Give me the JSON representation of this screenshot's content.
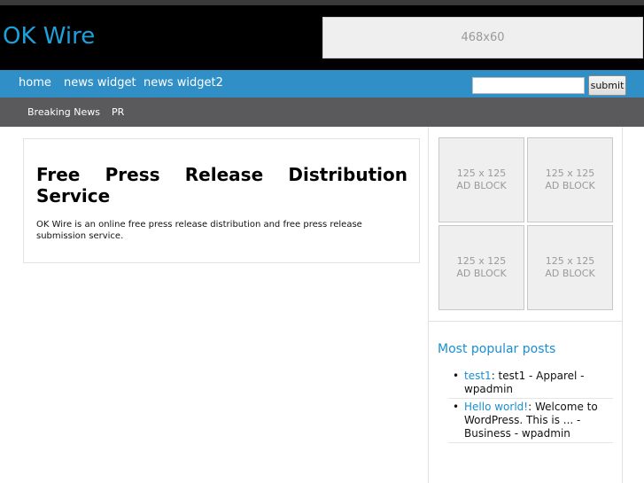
{
  "site": {
    "title": "OK Wire"
  },
  "banner": {
    "label": "468x60"
  },
  "nav": {
    "items": [
      {
        "label": "home"
      },
      {
        "label": "news widget"
      },
      {
        "label": "news widget2"
      }
    ],
    "search": {
      "value": "",
      "placeholder": "",
      "button_label": "submit"
    }
  },
  "subnav": {
    "items": [
      {
        "label": "Breaking News"
      },
      {
        "label": "PR"
      }
    ]
  },
  "post": {
    "title_line1": [
      "Free",
      "Press",
      "Release",
      "Distribution"
    ],
    "title_line2": "Service",
    "body": "OK Wire is an online free press release distribution and free press release submission service."
  },
  "ads": [
    {
      "size": "125 x 125",
      "label": "AD BLOCK"
    },
    {
      "size": "125 x 125",
      "label": "AD BLOCK"
    },
    {
      "size": "125 x 125",
      "label": "AD BLOCK"
    },
    {
      "size": "125 x 125",
      "label": "AD BLOCK"
    }
  ],
  "popular": {
    "title": "Most popular posts",
    "posts": [
      {
        "link": "test1",
        "rest": ": test1 - Apparel - wpadmin"
      },
      {
        "link": "Hello world!",
        "rest": ": Welcome to WordPress. This is ... - Business - wpadmin"
      }
    ]
  }
}
